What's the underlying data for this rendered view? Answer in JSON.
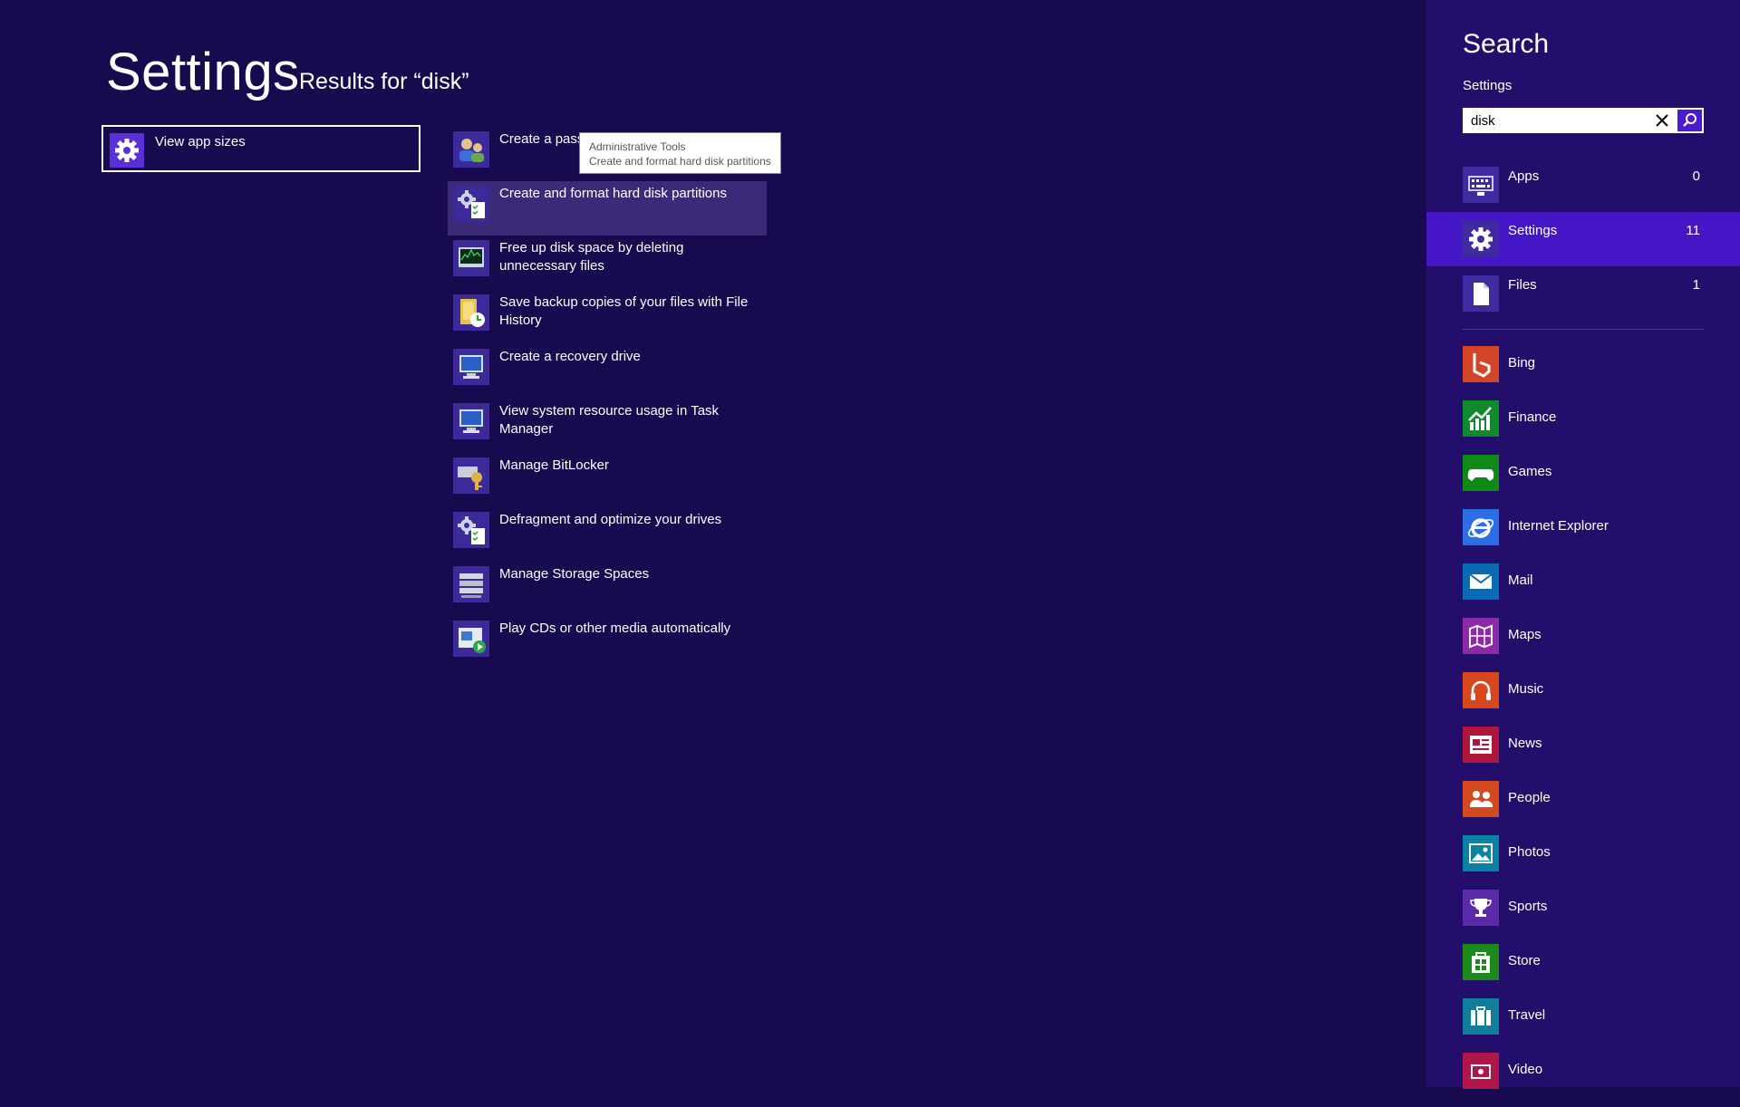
{
  "header": {
    "title": "Settings",
    "results_for": "Results for “disk”"
  },
  "left_results": [
    {
      "label": "View app sizes",
      "icon": "gear-icon"
    }
  ],
  "results": [
    {
      "label": "Create a passw",
      "icon": "users-icon"
    },
    {
      "label": "Create and format hard disk partitions",
      "icon": "admin-tools-icon"
    },
    {
      "label": "Free up disk space by deleting unnecessary files",
      "icon": "disk-cleanup-icon"
    },
    {
      "label": "Save backup copies of your files with File History",
      "icon": "file-history-icon"
    },
    {
      "label": "Create a recovery drive",
      "icon": "monitor-icon"
    },
    {
      "label": "View system resource usage in Task Manager",
      "icon": "monitor-icon"
    },
    {
      "label": "Manage BitLocker",
      "icon": "bitlocker-key-icon"
    },
    {
      "label": "Defragment and optimize your drives",
      "icon": "admin-tools-icon"
    },
    {
      "label": "Manage Storage Spaces",
      "icon": "storage-spaces-icon"
    },
    {
      "label": "Play CDs or other media automatically",
      "icon": "autoplay-icon"
    }
  ],
  "tooltip": {
    "title": "Administrative Tools",
    "description": "Create and format hard disk partitions"
  },
  "search_panel": {
    "title": "Search",
    "scope": "Settings",
    "query": "disk",
    "categories": [
      {
        "label": "Apps",
        "count": "0",
        "icon": "keyboard-icon"
      },
      {
        "label": "Settings",
        "count": "11",
        "icon": "gear-icon"
      },
      {
        "label": "Files",
        "count": "1",
        "icon": "file-icon"
      }
    ],
    "apps": [
      {
        "label": "Bing",
        "color": "#d34428",
        "icon": "bing-icon"
      },
      {
        "label": "Finance",
        "color": "#118a2e",
        "icon": "finance-icon"
      },
      {
        "label": "Games",
        "color": "#0f8a17",
        "icon": "gamepad-icon"
      },
      {
        "label": "Internet Explorer",
        "color": "#2d6ee6",
        "icon": "ie-icon"
      },
      {
        "label": "Mail",
        "color": "#0a6bb5",
        "icon": "mail-icon"
      },
      {
        "label": "Maps",
        "color": "#8c2aa8",
        "icon": "maps-icon"
      },
      {
        "label": "Music",
        "color": "#d9471e",
        "icon": "headphones-icon"
      },
      {
        "label": "News",
        "color": "#b0163a",
        "icon": "news-icon"
      },
      {
        "label": "People",
        "color": "#d4491f",
        "icon": "people-icon"
      },
      {
        "label": "Photos",
        "color": "#0a83a3",
        "icon": "photos-icon"
      },
      {
        "label": "Sports",
        "color": "#5a2aa8",
        "icon": "trophy-icon"
      },
      {
        "label": "Store",
        "color": "#1b8a1b",
        "icon": "store-icon"
      },
      {
        "label": "Travel",
        "color": "#0f7e9a",
        "icon": "suitcase-icon"
      },
      {
        "label": "Video",
        "color": "#b0164a",
        "icon": "video-icon"
      }
    ]
  }
}
